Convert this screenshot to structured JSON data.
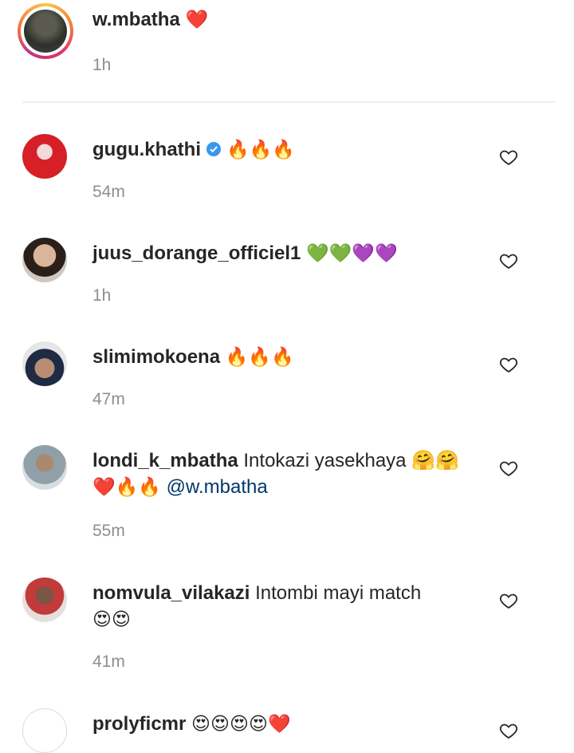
{
  "caption": {
    "username": "w.mbatha",
    "text": "❤️",
    "time": "1h"
  },
  "comments": [
    {
      "username": "gugu.khathi",
      "verified": true,
      "text": "🔥🔥🔥",
      "time": "54m",
      "avatar_color": "#d61f26"
    },
    {
      "username": "juus_dorange_officiel1",
      "text": "💚💚💜💜",
      "time": "1h",
      "avatar_color": "#c9a58a"
    },
    {
      "username": "slimimokoena",
      "text": "🔥🔥🔥",
      "time": "47m",
      "avatar_color": "#1f2a44"
    },
    {
      "username": "londi_k_mbatha",
      "text": "Intokazi yasekhaya 🤗🤗",
      "text2": "❤️🔥🔥",
      "mention": "@w.mbatha",
      "time": "55m",
      "avatar_color": "#8fa0a8"
    },
    {
      "username": "nomvula_vilakazi",
      "text": "Intombi mayi match",
      "text2": "😍😍",
      "time": "41m",
      "avatar_color": "#5b3b3b"
    },
    {
      "username": "prolyficmr",
      "text": "😍😍😍😍❤️",
      "avatar_color": "#ffffff"
    }
  ],
  "colors": {
    "username": "#262626",
    "time": "#8e8e8e",
    "mention": "#00376b",
    "verified": "#3897f0",
    "divider": "#efefef"
  },
  "icons": {
    "like": "heart-outline-icon",
    "verified": "verified-badge-icon"
  }
}
